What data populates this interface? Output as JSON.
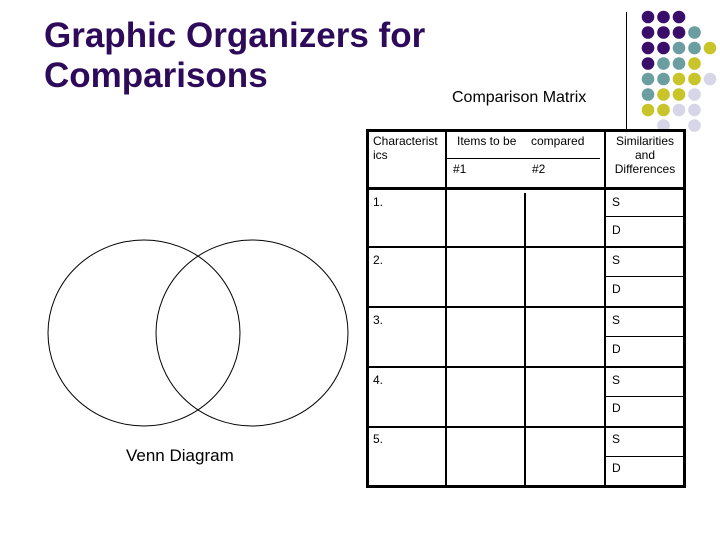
{
  "slide": {
    "title_line1": "Graphic Organizers for",
    "title_line2": "Comparisons",
    "title_color": "#2e0a5a"
  },
  "matrix": {
    "label": "Comparison Matrix",
    "headers": {
      "characteristics_line1": "Characterist",
      "characteristics_line2": "ics",
      "items_left": "Items to be",
      "items_right": "compared",
      "item1": "#1",
      "item2": "#2",
      "simdiff_line1": "Similarities",
      "simdiff_line2": "and",
      "simdiff_line3": "Differences"
    },
    "rows": [
      {
        "label": "1.",
        "s": "S",
        "d": "D"
      },
      {
        "label": "2.",
        "s": "S",
        "d": "D"
      },
      {
        "label": "3.",
        "s": "S",
        "d": "D"
      },
      {
        "label": "4.",
        "s": "S",
        "d": "D"
      },
      {
        "label": "5.",
        "s": "S",
        "d": "D"
      }
    ]
  },
  "venn": {
    "label": "Venn Diagram"
  },
  "decoration": {
    "palette": {
      "P": "#3a0d6b",
      "T": "#6b9ea0",
      "Y": "#c8c42a",
      "L": "#d6d6e8"
    },
    "dot_grid": [
      "PPP..",
      "PPPT.",
      "PPTTY",
      "PTTY.",
      "TTYYL",
      "TYYL.",
      "YYLL.",
      ".L.L."
    ]
  }
}
